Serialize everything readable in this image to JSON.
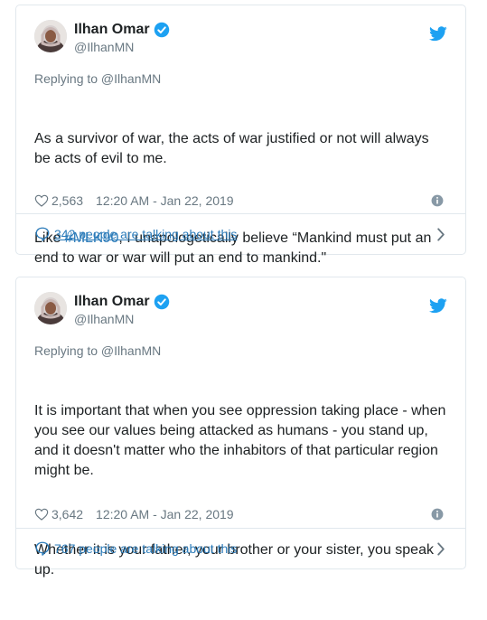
{
  "tweets": [
    {
      "display_name": "Ilhan Omar",
      "screen_name": "@IlhanMN",
      "replying_to": "Replying to @IlhanMN",
      "paragraphs": [
        "As a survivor of war, the acts of war justified or not will always be acts of evil to me."
      ],
      "paragraph2_before": "Like ",
      "hashtag": "#MLK90",
      "paragraph2_after": ", I unapologetically believe “Mankind must put an end to war or war will put an end to mankind.\"",
      "likes": "2,563",
      "timestamp": "12:20 AM - Jan 22, 2019",
      "talking": "342 people are talking about this"
    },
    {
      "display_name": "Ilhan Omar",
      "screen_name": "@IlhanMN",
      "replying_to": "Replying to @IlhanMN",
      "paragraphs": [
        "It is important that when you see oppression taking place - when you see our values being attacked as humans - you stand up, and it doesn't matter who the inhabitors of that particular region might be.",
        "Whether it is your father, your brother or your sister, you speak up."
      ],
      "likes": "3,642",
      "timestamp": "12:20 AM - Jan 22, 2019",
      "talking": "767 people are talking about this"
    }
  ],
  "colors": {
    "link": "#2b7bb9",
    "twitter_blue": "#1da1f2",
    "muted": "#697882",
    "border": "#e1e8ed"
  },
  "icons": [
    "verified-badge-icon",
    "twitter-bird-icon",
    "heart-icon",
    "info-icon",
    "speech-bubble-icon",
    "chevron-right-icon"
  ]
}
